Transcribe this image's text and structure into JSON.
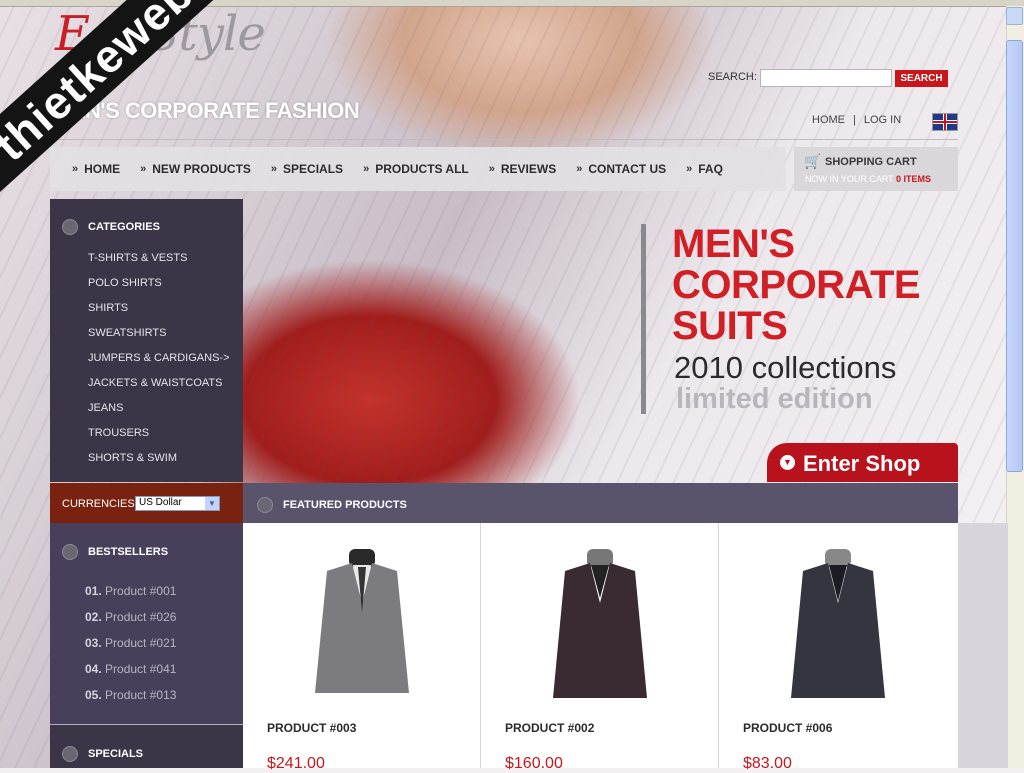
{
  "header": {
    "logo_part1": "Ego",
    "logo_part2": "Style",
    "tagline": "MEN'S CORPORATE FASHION",
    "watermark": "thietkeweb.com",
    "search_label": "SEARCH:",
    "search_value": "",
    "search_button": "SEARCH",
    "links": {
      "home": "HOME",
      "separator": "|",
      "login": "LOG IN"
    },
    "flag_icon": "uk-flag-icon"
  },
  "nav": {
    "items": [
      {
        "label": "HOME"
      },
      {
        "label": "NEW PRODUCTS"
      },
      {
        "label": "SPECIALS"
      },
      {
        "label": "PRODUCTS ALL"
      },
      {
        "label": "REVIEWS"
      },
      {
        "label": "CONTACT US"
      },
      {
        "label": "FAQ"
      }
    ]
  },
  "cart": {
    "title": "SHOPPING CART",
    "status_text": "NOW IN YOUR CART",
    "count": "0 ITEMS",
    "icon": "cart-icon"
  },
  "sidebar": {
    "categories": {
      "title": "CATEGORIES",
      "items": [
        "T-SHIRTS & VESTS",
        "POLO SHIRTS",
        "SHIRTS",
        "SWEATSHIRTS",
        "JUMPERS & CARDIGANS->",
        "JACKETS & WAISTCOATS",
        "JEANS",
        "TROUSERS",
        "SHORTS & SWIM"
      ]
    },
    "currencies": {
      "label": "CURRENCIES:",
      "selected": "US Dollar"
    },
    "bestsellers": {
      "title": "BESTSELLERS",
      "items": [
        {
          "num": "01.",
          "name": "Product #001"
        },
        {
          "num": "02.",
          "name": "Product #026"
        },
        {
          "num": "03.",
          "name": "Product #021"
        },
        {
          "num": "04.",
          "name": "Product #041"
        },
        {
          "num": "05.",
          "name": "Product #013"
        }
      ]
    },
    "specials": {
      "title": "SPECIALS"
    }
  },
  "banner": {
    "line1": "MEN'S",
    "line2": "CORPORATE",
    "line3": "SUITS",
    "subtitle": "2010 collections",
    "edition": "limited edition",
    "button": "Enter Shop"
  },
  "featured": {
    "title": "FEATURED PRODUCTS",
    "products": [
      {
        "name": "PRODUCT #003",
        "price": "$241.00",
        "suit_color": "#7b7b80"
      },
      {
        "name": "PRODUCT #002",
        "price": "$160.00",
        "suit_color": "#3a2a32"
      },
      {
        "name": "PRODUCT #006",
        "price": "$83.00",
        "suit_color": "#34353e"
      }
    ]
  },
  "colors": {
    "accent": "#c8161d",
    "sidebar": "#3c3548",
    "currency_bar": "#7a2210"
  }
}
